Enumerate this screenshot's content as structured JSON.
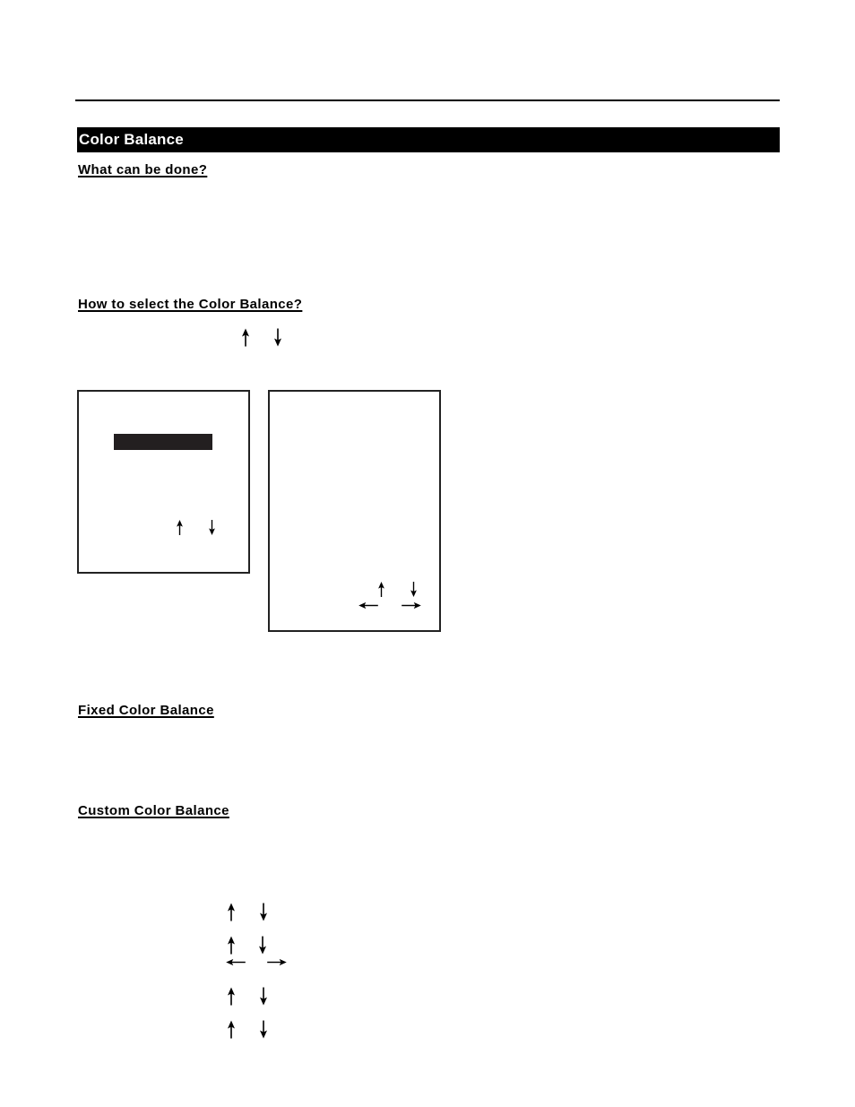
{
  "page": {
    "section_title": "Color Balance",
    "colors": {
      "text": "#000000",
      "section_bar_bg": "#000000",
      "section_bar_text": "#ffffff",
      "osd_highlight": "#231f20",
      "background": "#ffffff"
    }
  },
  "sections": {
    "what_can_be_done": {
      "heading": "What can be done?"
    },
    "how_to_select": {
      "heading": "How to select the Color Balance?",
      "key_icons": [
        "arrow-up-icon",
        "arrow-down-icon"
      ]
    },
    "fixed_color_balance": {
      "heading": "Fixed Color Balance"
    },
    "custom_color_balance": {
      "heading": "Custom Color Balance",
      "steps": [
        {
          "icons": [
            "arrow-up-icon",
            "arrow-down-icon"
          ]
        },
        {
          "icons": [
            "arrow-up-icon",
            "arrow-down-icon",
            "arrow-left-icon",
            "arrow-right-icon"
          ]
        },
        {
          "icons": [
            "arrow-up-icon",
            "arrow-down-icon"
          ]
        },
        {
          "icons": [
            "arrow-up-icon",
            "arrow-down-icon"
          ]
        }
      ]
    }
  },
  "osd_menus": [
    {
      "name": "menu-screen-1",
      "has_highlight_bar": true,
      "key_icons": [
        "arrow-up-icon",
        "arrow-down-icon"
      ]
    },
    {
      "name": "menu-screen-2",
      "has_highlight_bar": false,
      "key_icons": [
        "arrow-up-icon",
        "arrow-down-icon",
        "arrow-left-icon",
        "arrow-right-icon"
      ]
    }
  ]
}
